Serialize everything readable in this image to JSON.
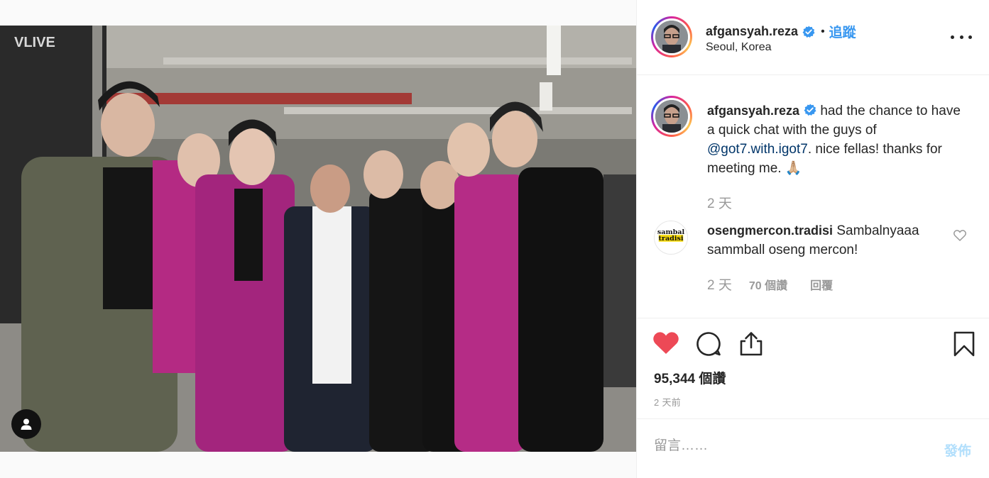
{
  "post": {
    "username": "afgansyah.reza",
    "follow_label": "追蹤",
    "separator": "•",
    "location": "Seoul, Korea",
    "photo_sign_text": "VLIVE"
  },
  "caption": {
    "username": "afgansyah.reza",
    "text_before": "had the chance to have a quick chat with the guys of ",
    "mention": "@got7.with.igot7",
    "text_after": ". nice fellas! thanks for meeting me. 🙏🏼",
    "time": "2 天"
  },
  "comment": {
    "username": "osengmercon.tradisi",
    "text": "Sambalnyaaa sammball oseng mercon!",
    "time": "2 天",
    "likes": "70 個讚",
    "reply": "回覆",
    "avatar_text_line1": "sambal",
    "avatar_text_line2": "tradisi"
  },
  "actions": {
    "likes_count": "95,344 個讚",
    "post_time": "2 天前",
    "like_color": "#ed4956",
    "icons": [
      "heart-icon",
      "comment-icon",
      "share-icon",
      "bookmark-icon"
    ]
  },
  "comment_box": {
    "placeholder": "留言……",
    "post_label": "發佈"
  },
  "colors": {
    "link": "#3897f0",
    "verified": "#3897f0",
    "muted": "#999999"
  }
}
